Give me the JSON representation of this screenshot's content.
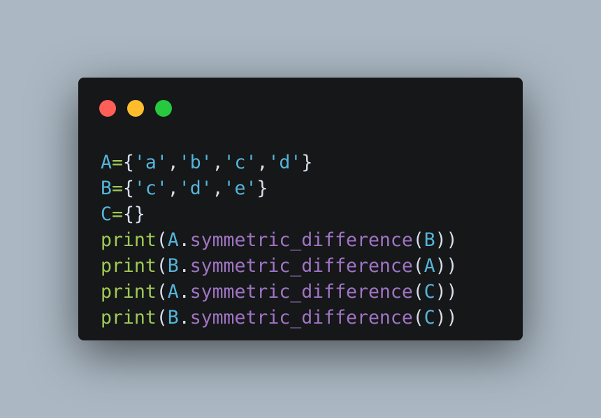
{
  "window_controls": {
    "close_color": "#ff5f56",
    "minimize_color": "#ffbd2e",
    "maximize_color": "#27c93f"
  },
  "colors": {
    "background": "#abb8c3",
    "editor_background": "#151718",
    "variable": "#55b5db",
    "operator": "#9fca56",
    "punctuation": "#d6deeb",
    "string": "#55b5db",
    "function": "#9fca56",
    "method": "#a074c4"
  },
  "code": {
    "lines": [
      [
        {
          "t": "A",
          "k": "var"
        },
        {
          "t": "=",
          "k": "op"
        },
        {
          "t": "{",
          "k": "punc"
        },
        {
          "t": "'a'",
          "k": "str"
        },
        {
          "t": ",",
          "k": "punc"
        },
        {
          "t": "'b'",
          "k": "str"
        },
        {
          "t": ",",
          "k": "punc"
        },
        {
          "t": "'c'",
          "k": "str"
        },
        {
          "t": ",",
          "k": "punc"
        },
        {
          "t": "'d'",
          "k": "str"
        },
        {
          "t": "}",
          "k": "punc"
        }
      ],
      [
        {
          "t": "B",
          "k": "var"
        },
        {
          "t": "=",
          "k": "op"
        },
        {
          "t": "{",
          "k": "punc"
        },
        {
          "t": "'c'",
          "k": "str"
        },
        {
          "t": ",",
          "k": "punc"
        },
        {
          "t": "'d'",
          "k": "str"
        },
        {
          "t": ",",
          "k": "punc"
        },
        {
          "t": "'e'",
          "k": "str"
        },
        {
          "t": "}",
          "k": "punc"
        }
      ],
      [
        {
          "t": "C",
          "k": "var"
        },
        {
          "t": "=",
          "k": "op"
        },
        {
          "t": "{}",
          "k": "punc"
        }
      ],
      [
        {
          "t": "print",
          "k": "fn"
        },
        {
          "t": "(",
          "k": "punc"
        },
        {
          "t": "A",
          "k": "var"
        },
        {
          "t": ".",
          "k": "punc"
        },
        {
          "t": "symmetric_difference",
          "k": "method"
        },
        {
          "t": "(",
          "k": "punc"
        },
        {
          "t": "B",
          "k": "var"
        },
        {
          "t": "))",
          "k": "punc"
        }
      ],
      [
        {
          "t": "print",
          "k": "fn"
        },
        {
          "t": "(",
          "k": "punc"
        },
        {
          "t": "B",
          "k": "var"
        },
        {
          "t": ".",
          "k": "punc"
        },
        {
          "t": "symmetric_difference",
          "k": "method"
        },
        {
          "t": "(",
          "k": "punc"
        },
        {
          "t": "A",
          "k": "var"
        },
        {
          "t": "))",
          "k": "punc"
        }
      ],
      [
        {
          "t": "print",
          "k": "fn"
        },
        {
          "t": "(",
          "k": "punc"
        },
        {
          "t": "A",
          "k": "var"
        },
        {
          "t": ".",
          "k": "punc"
        },
        {
          "t": "symmetric_difference",
          "k": "method"
        },
        {
          "t": "(",
          "k": "punc"
        },
        {
          "t": "C",
          "k": "var"
        },
        {
          "t": "))",
          "k": "punc"
        }
      ],
      [
        {
          "t": "print",
          "k": "fn"
        },
        {
          "t": "(",
          "k": "punc"
        },
        {
          "t": "B",
          "k": "var"
        },
        {
          "t": ".",
          "k": "punc"
        },
        {
          "t": "symmetric_difference",
          "k": "method"
        },
        {
          "t": "(",
          "k": "punc"
        },
        {
          "t": "C",
          "k": "var"
        },
        {
          "t": "))",
          "k": "punc"
        }
      ]
    ]
  }
}
